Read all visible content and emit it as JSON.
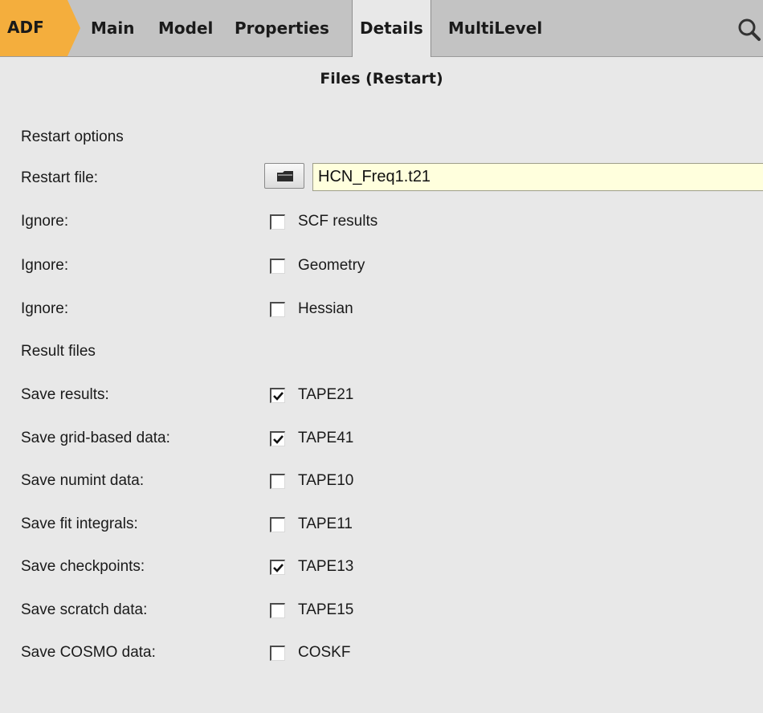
{
  "tabs": {
    "adf": "ADF",
    "items": [
      "Main",
      "Model",
      "Properties",
      "Details",
      "MultiLevel"
    ],
    "active": "Details"
  },
  "panel_title": "Files (Restart)",
  "sections": {
    "restart": "Restart options",
    "results": "Result files"
  },
  "restart_file": {
    "label": "Restart file:",
    "value": "HCN_Freq1.t21"
  },
  "ignore": [
    {
      "label": "Ignore:",
      "option": "SCF results",
      "checked": false
    },
    {
      "label": "Ignore:",
      "option": "Geometry",
      "checked": false
    },
    {
      "label": "Ignore:",
      "option": "Hessian",
      "checked": false
    }
  ],
  "saves": [
    {
      "label": "Save results:",
      "option": "TAPE21",
      "checked": true
    },
    {
      "label": "Save grid-based data:",
      "option": "TAPE41",
      "checked": true
    },
    {
      "label": "Save numint data:",
      "option": "TAPE10",
      "checked": false
    },
    {
      "label": "Save fit integrals:",
      "option": "TAPE11",
      "checked": false
    },
    {
      "label": "Save checkpoints:",
      "option": "TAPE13",
      "checked": true
    },
    {
      "label": "Save scratch data:",
      "option": "TAPE15",
      "checked": false
    },
    {
      "label": "Save COSMO data:",
      "option": "COSKF",
      "checked": false
    }
  ],
  "icons": {
    "search": "search-icon",
    "folder": "folder-icon",
    "check": "checkmark-icon"
  },
  "colors": {
    "adf_accent": "#f4ae3d",
    "input_background": "#ffffdd"
  }
}
